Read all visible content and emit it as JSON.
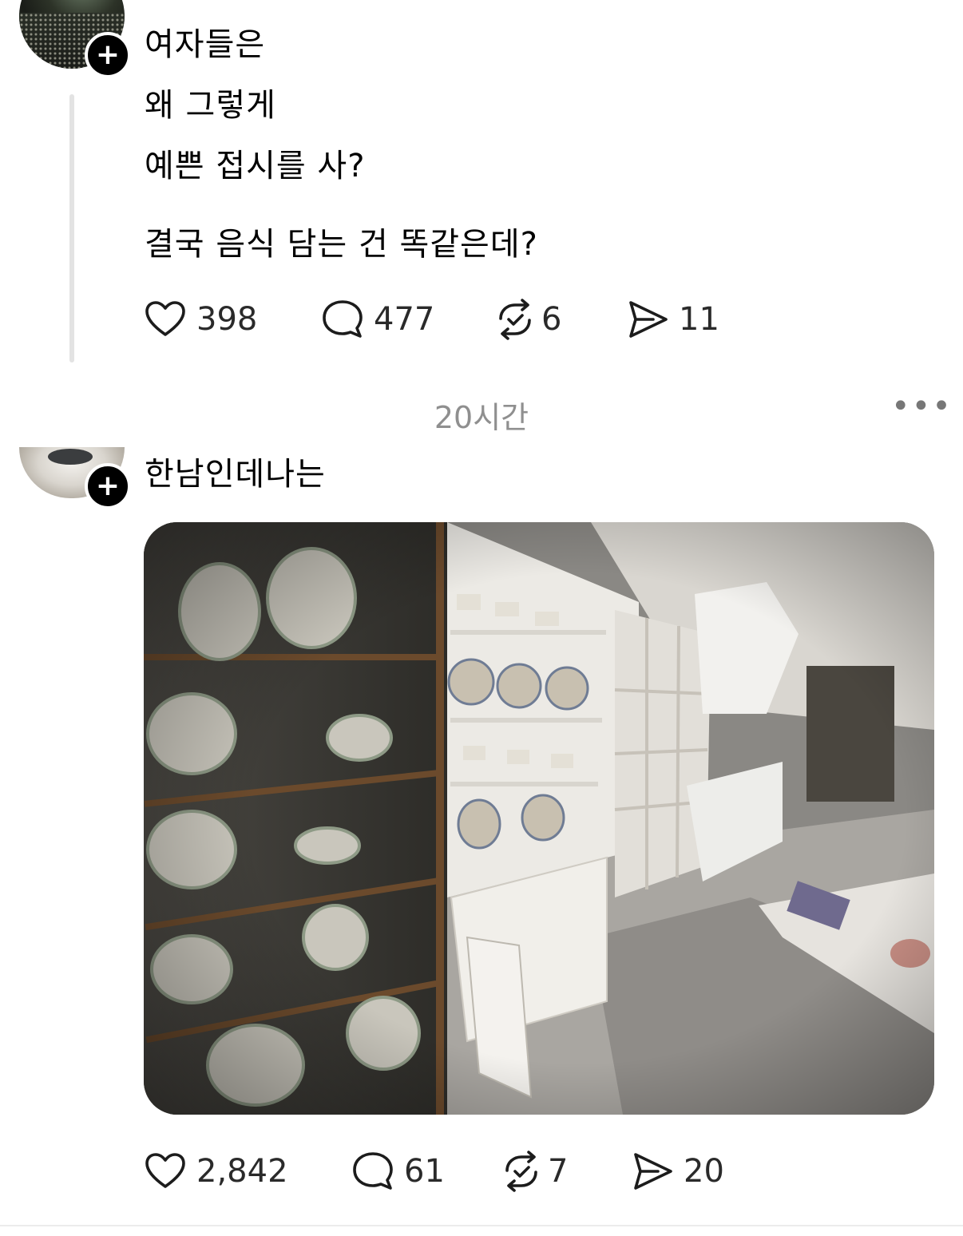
{
  "post1": {
    "lines": [
      "여자들은",
      "왜 그렇게",
      "예쁜 접시를 사?",
      "결국 음식 담는 건 똑같은데?"
    ],
    "likes": "398",
    "replies": "477",
    "reposts": "6",
    "shares": "11"
  },
  "timestamp": "20시간",
  "more_label": "•••",
  "post2": {
    "text": "한남인데나는",
    "likes": "2,842",
    "replies": "61",
    "reposts": "7",
    "shares": "20"
  },
  "follow_symbol": "+"
}
